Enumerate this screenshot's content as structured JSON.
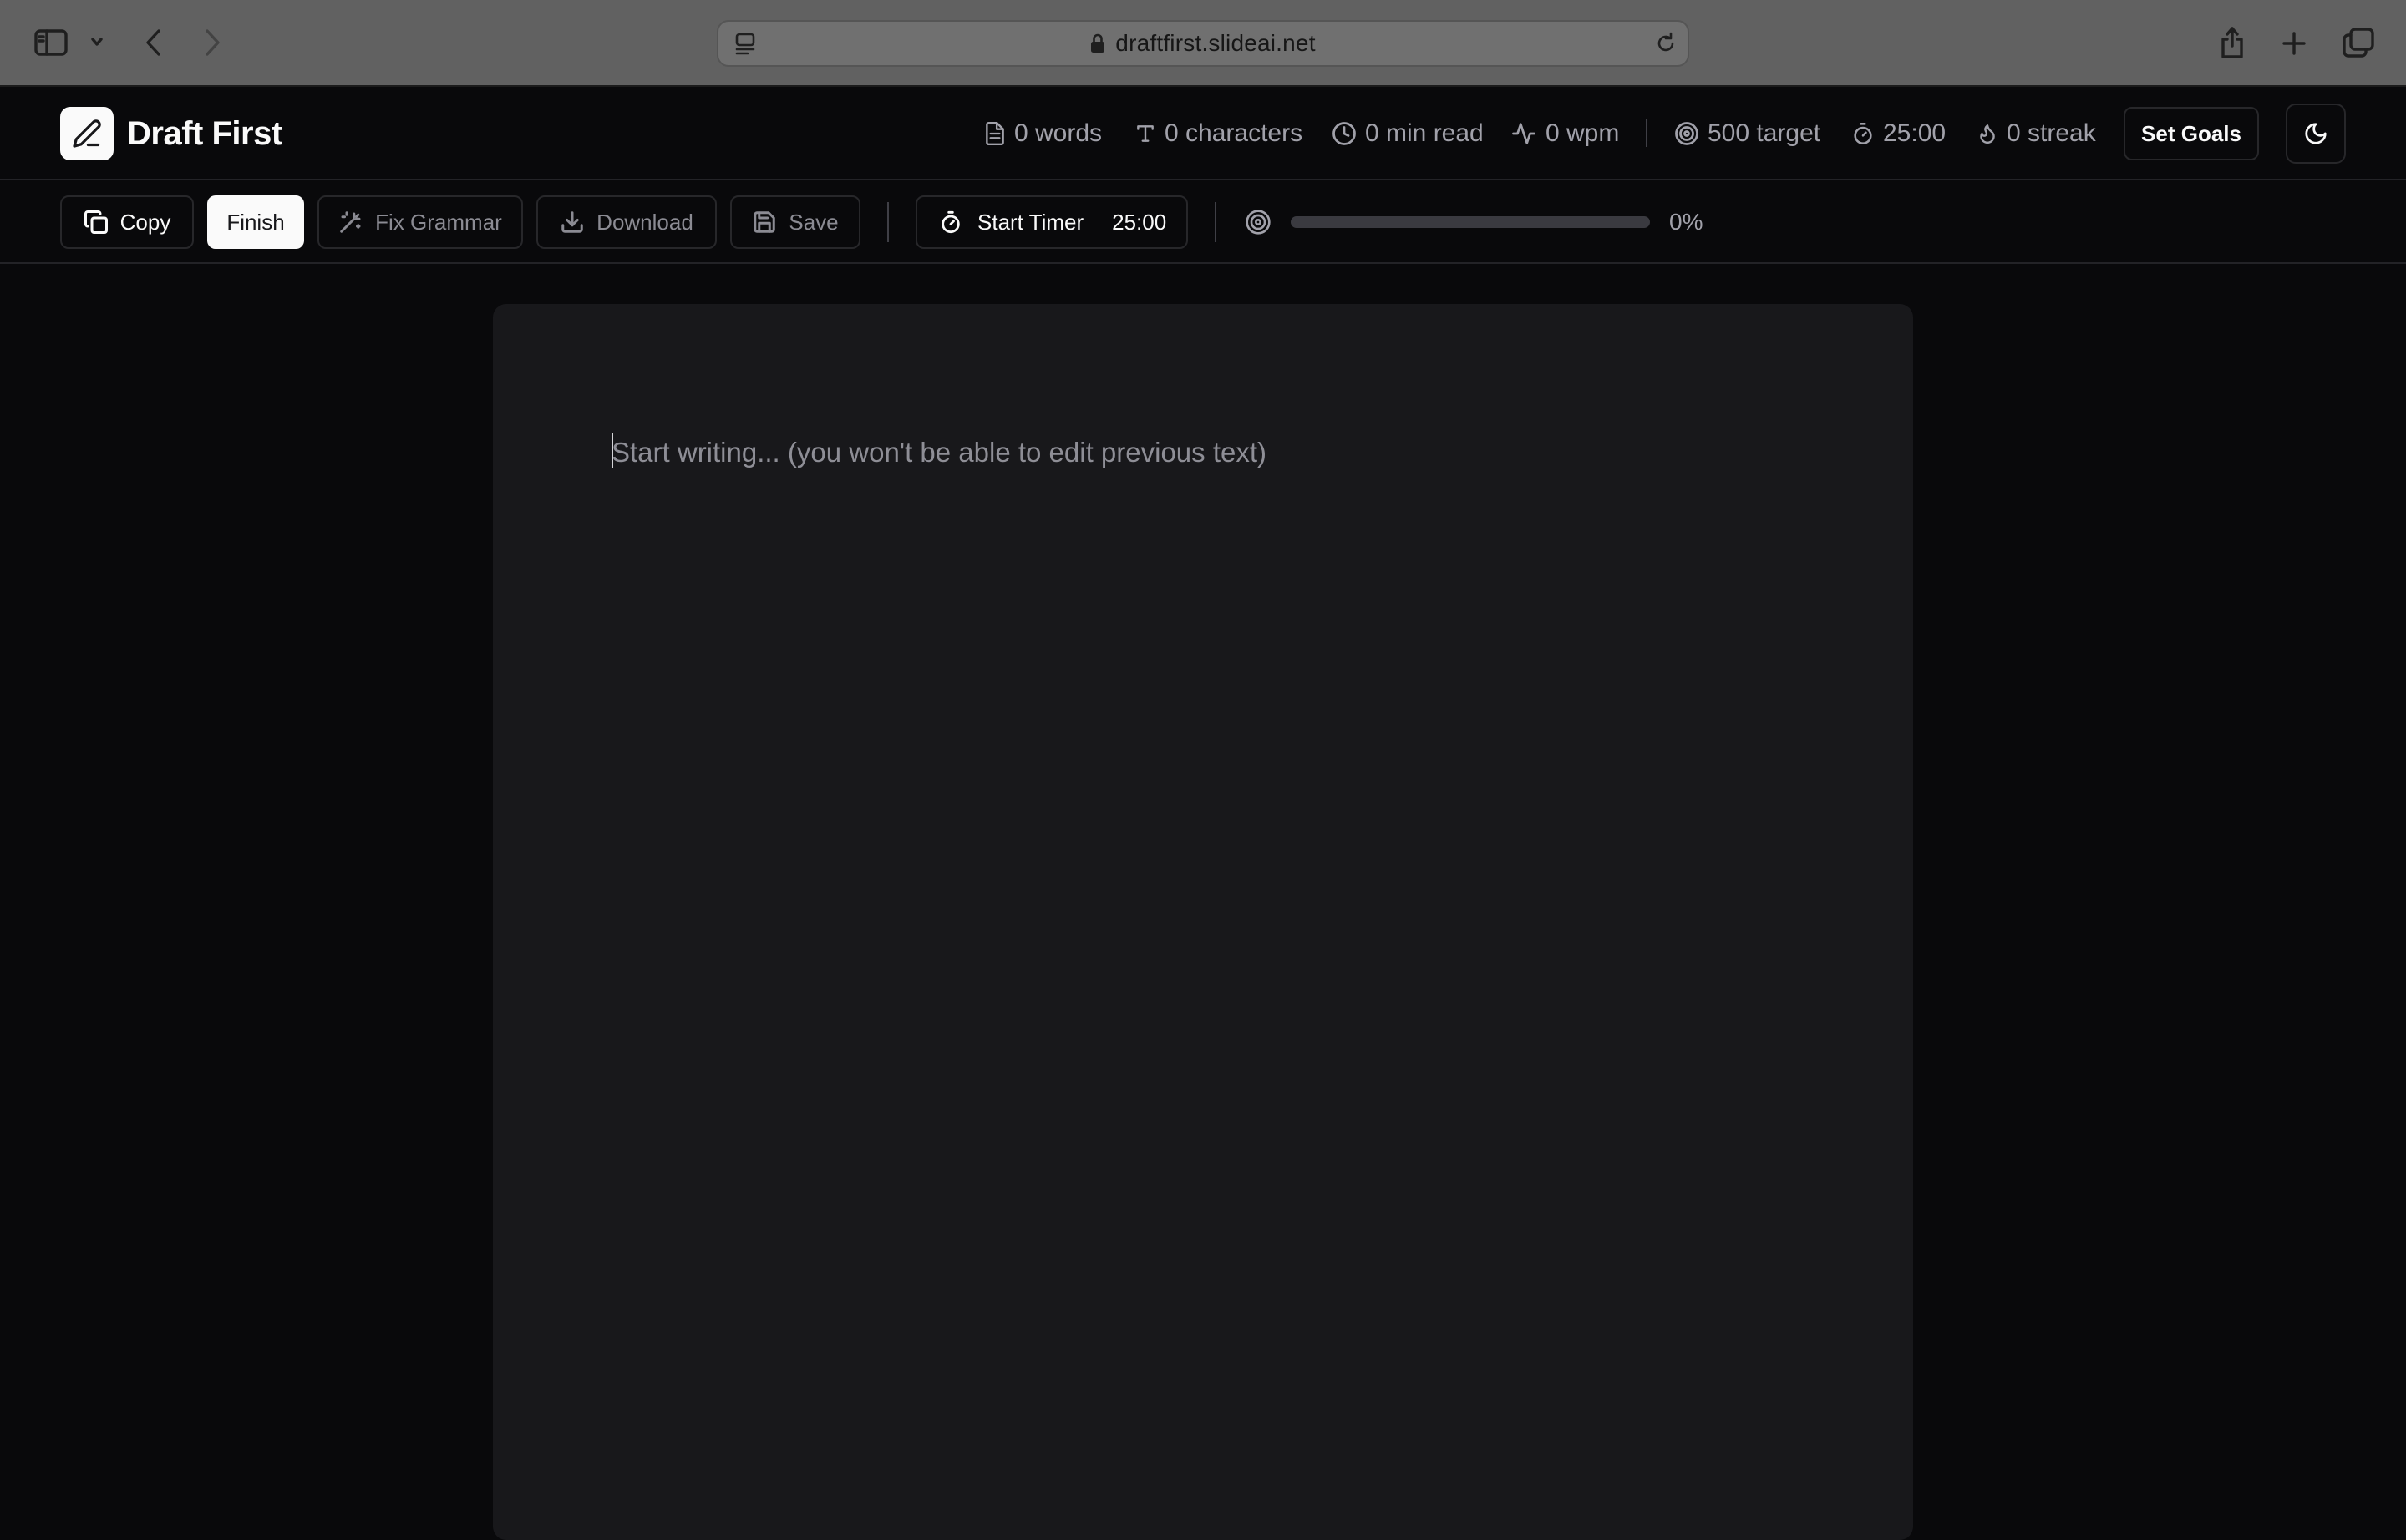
{
  "browser": {
    "url": "draftfirst.slideai.net"
  },
  "app": {
    "title": "Draft First"
  },
  "stats": {
    "words": "0 words",
    "characters": "0 characters",
    "read_time": "0 min read",
    "wpm": "0 wpm",
    "target": "500 target",
    "timer": "25:00",
    "streak": "0 streak"
  },
  "header": {
    "set_goals_label": "Set Goals"
  },
  "toolbar": {
    "copy_label": "Copy",
    "finish_label": "Finish",
    "fix_grammar_label": "Fix Grammar",
    "download_label": "Download",
    "save_label": "Save",
    "start_timer_label": "Start Timer",
    "timer_value": "25:00",
    "progress_percent": "0%",
    "progress_fraction": 0
  },
  "editor": {
    "placeholder": "Start writing... (you won't be able to edit previous text)",
    "value": ""
  },
  "colors": {
    "background": "#09090b",
    "editor_background": "#18181b",
    "primary_button": "#fafafa",
    "muted_text": "#a1a1aa"
  },
  "icons": {
    "logo": "pencil-icon",
    "words": "file-text-icon",
    "characters": "type-icon",
    "read_time": "clock-icon",
    "wpm": "activity-icon",
    "target": "target-icon",
    "timer": "timer-icon",
    "streak": "flame-icon",
    "theme": "moon-icon"
  }
}
